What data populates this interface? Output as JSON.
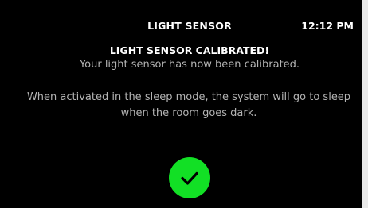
{
  "header": {
    "title": "LIGHT SENSOR",
    "clock": "12:12 PM"
  },
  "message": {
    "headline": "LIGHT SENSOR CALIBRATED!",
    "subline": "Your light sensor has now been calibrated.",
    "body": "When activated in the sleep mode, the system will go to sleep when the room goes dark."
  },
  "confirm_button": {
    "icon": "checkmark-icon",
    "color": "#12e025"
  },
  "colors": {
    "background": "#000000",
    "primary_text": "#ffffff",
    "secondary_text": "#b3b3b3",
    "bezel": "#e9e9e9"
  }
}
